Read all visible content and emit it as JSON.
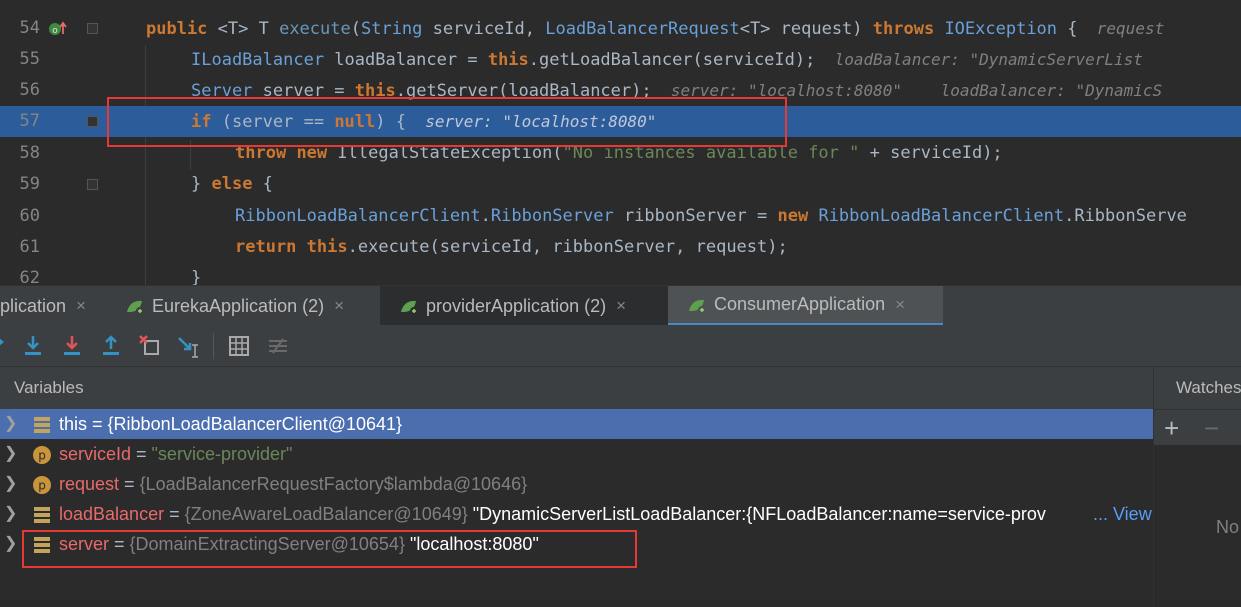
{
  "editor": {
    "lines": [
      {
        "num": "54"
      },
      {
        "num": "55"
      },
      {
        "num": "56"
      },
      {
        "num": "57"
      },
      {
        "num": "58"
      },
      {
        "num": "59"
      },
      {
        "num": "60"
      },
      {
        "num": "61"
      },
      {
        "num": "62"
      }
    ],
    "line54": {
      "kw1": "public",
      "t1": " <T> T ",
      "fn": "execute",
      "t2": "(",
      "ty": "String",
      "t3": " serviceId, ",
      "ty2": "LoadBalancerRequest",
      "t4": "<T> request) ",
      "kw2": "throws",
      "t5": " ",
      "ty3": "IOException",
      "t6": " {",
      "hint": "  request"
    },
    "line55": {
      "ty": "ILoadBalancer",
      "t1": " loadBalancer = ",
      "kw": "this",
      "t2": ".getLoadBalancer(serviceId);",
      "hint": "  loadBalancer: \"DynamicServerList"
    },
    "line56": {
      "ty": "Server",
      "t1": " server = ",
      "kw": "this",
      "t2": ".getServer(loadBalancer);",
      "hint1": "  server: \"localhost:8080\"",
      "hint2": "    loadBalancer: \"DynamicS"
    },
    "line57": {
      "kw": "if",
      "t1": " (server == ",
      "kw2": "null",
      "t2": ") {",
      "hint": "  server: \"localhost:8080\""
    },
    "line58": {
      "kw": "throw",
      "t1": " ",
      "kw2": "new",
      "t2": " IllegalStateException(",
      "str": "\"No instances available for \"",
      "t3": " + serviceId);"
    },
    "line59": {
      "t1": "} ",
      "kw": "else",
      "t2": " {"
    },
    "line60": {
      "ty": "RibbonLoadBalancerClient",
      "t1": ".",
      "ty2": "RibbonServer",
      "t2": " ribbonServer = ",
      "kw": "new",
      "t3": " ",
      "ty3": "RibbonLoadBalancerClient",
      "t4": ".RibbonServe"
    },
    "line61": {
      "kw": "return",
      "t1": " ",
      "kw2": "this",
      "t2": ".execute(serviceId, ribbonServer, request);"
    },
    "line62": {
      "t1": "}"
    }
  },
  "tabs": [
    {
      "label": "plication",
      "active": false
    },
    {
      "label": "EurekaApplication (2)",
      "active": false
    },
    {
      "label": "providerApplication (2)",
      "active": false
    },
    {
      "label": "ConsumerApplication",
      "active": true
    }
  ],
  "tab_close": "×",
  "toolbar": {
    "icons": [
      "step-over-icon",
      "step-into-icon",
      "force-step-into-icon",
      "step-out-icon",
      "drop-frame-icon",
      "run-to-cursor-icon",
      "evaluate-expression-icon",
      "trace-current-stream-icon"
    ]
  },
  "variables": {
    "header": "Variables",
    "rows": [
      {
        "name": "this",
        "eq": " = ",
        "type": "{RibbonLoadBalancerClient@10641}",
        "value": "",
        "icon": "field-icon",
        "selected": true
      },
      {
        "name": "serviceId",
        "eq": " = ",
        "type": "",
        "value": "\"service-provider\"",
        "icon": "parameter-icon",
        "selected": false
      },
      {
        "name": "request",
        "eq": " = ",
        "type": "{LoadBalancerRequestFactory$lambda@10646}",
        "value": "",
        "icon": "parameter-icon",
        "selected": false
      },
      {
        "name": "loadBalancer",
        "eq": " = ",
        "type": "{ZoneAwareLoadBalancer@10649}",
        "value": " \"DynamicServerListLoadBalancer:{NFLoadBalancer:name=service-prov",
        "more": "... View",
        "icon": "field-icon",
        "selected": false
      },
      {
        "name": "server",
        "eq": " = ",
        "type": "{DomainExtractingServer@10654}",
        "value": " \"localhost:8080\"",
        "icon": "field-icon",
        "selected": false
      }
    ]
  },
  "watches": {
    "header": "Watches",
    "add": "+",
    "remove": "−",
    "empty": "No"
  },
  "colors": {
    "highlight_box": "#e53935",
    "exec_line": "#2d5c9b",
    "selected_row": "#4b6eaf"
  }
}
